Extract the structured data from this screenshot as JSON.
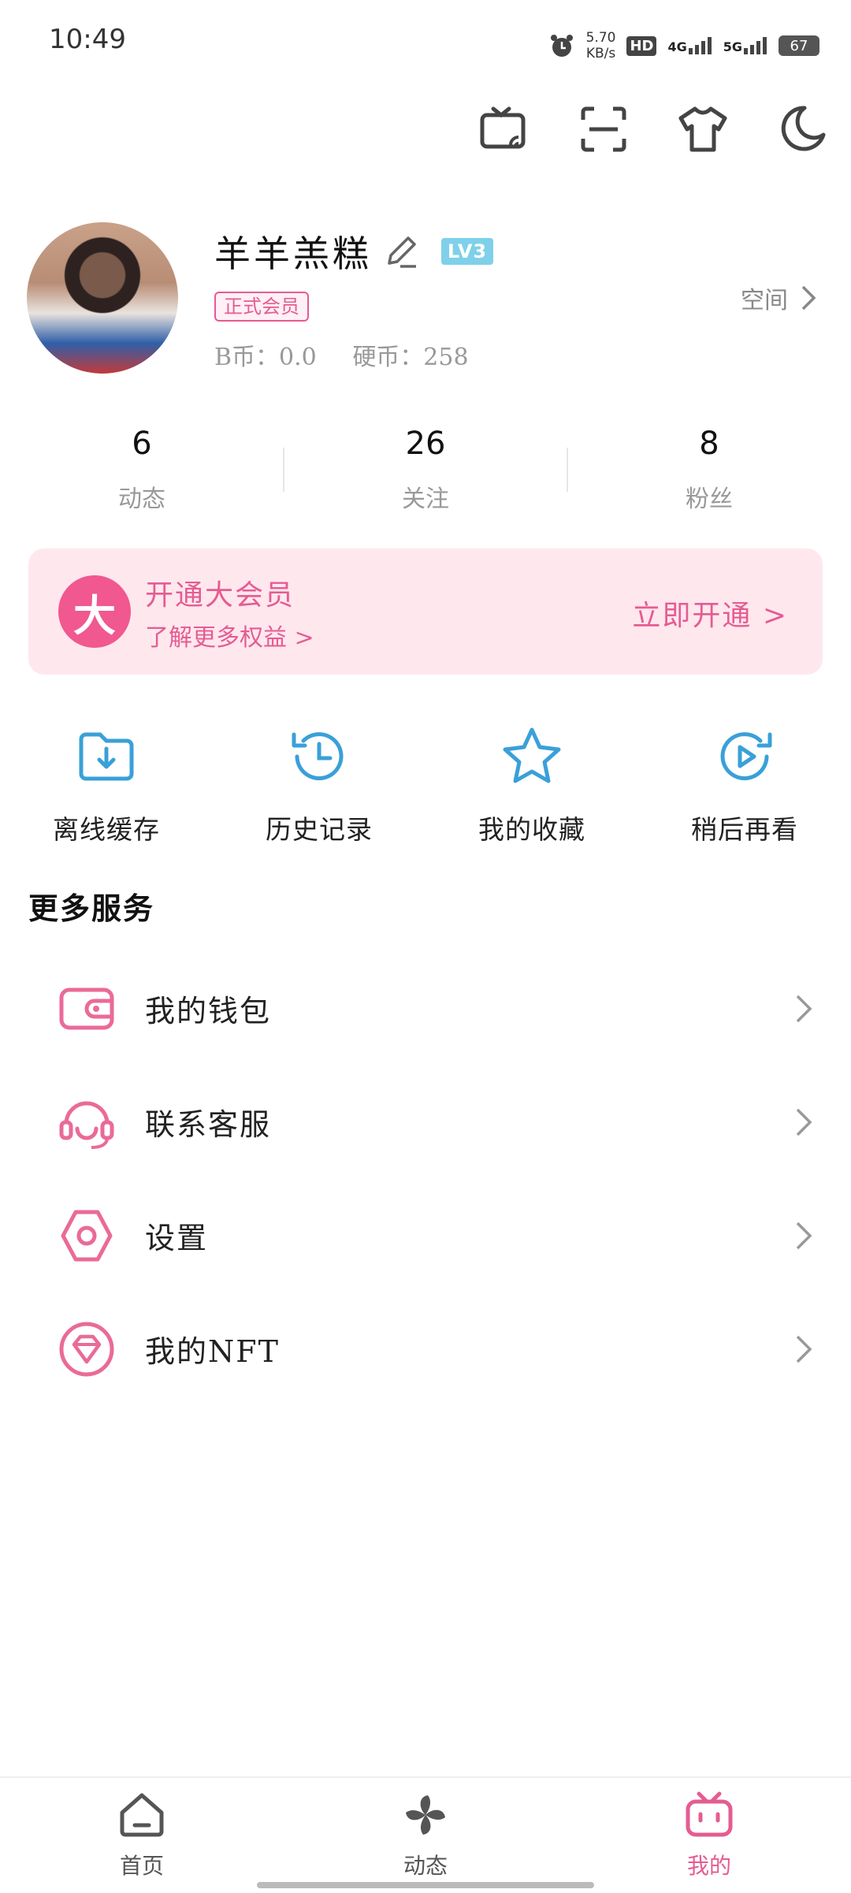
{
  "status_bar": {
    "time": "10:49",
    "speed_value": "5.70",
    "speed_unit": "KB/s",
    "hd": "HD",
    "net1": "4G",
    "net2": "5G",
    "battery": "67"
  },
  "top_actions": [
    "tv-cast-icon",
    "scan-icon",
    "tshirt-icon",
    "moon-icon"
  ],
  "profile": {
    "username": "羊羊羔糕",
    "level": "LV3",
    "vip_tag": "正式会员",
    "b_coin_label": "B币：0.0",
    "coin_label": "硬币：258",
    "space_link": "空间"
  },
  "stats": [
    {
      "value": "6",
      "label": "动态"
    },
    {
      "value": "26",
      "label": "关注"
    },
    {
      "value": "8",
      "label": "粉丝"
    }
  ],
  "vip_banner": {
    "badge": "大",
    "title": "开通大会员",
    "subtitle": "了解更多权益 >",
    "cta": "立即开通 >"
  },
  "quick_actions": [
    {
      "label": "离线缓存",
      "icon": "download-folder-icon"
    },
    {
      "label": "历史记录",
      "icon": "history-icon"
    },
    {
      "label": "我的收藏",
      "icon": "star-icon"
    },
    {
      "label": "稍后再看",
      "icon": "watch-later-icon"
    }
  ],
  "services": {
    "title": "更多服务",
    "items": [
      {
        "label": "我的钱包",
        "icon": "wallet-icon"
      },
      {
        "label": "联系客服",
        "icon": "headset-icon"
      },
      {
        "label": "设置",
        "icon": "settings-icon"
      },
      {
        "label": "我的NFT",
        "icon": "diamond-icon"
      }
    ]
  },
  "tabs": [
    {
      "label": "首页",
      "icon": "home-icon",
      "active": false
    },
    {
      "label": "动态",
      "icon": "pinwheel-icon",
      "active": false
    },
    {
      "label": "我的",
      "icon": "tv-mascot-icon",
      "active": true
    }
  ],
  "colors": {
    "accent": "#e55c92",
    "blue_icon": "#3aa0d8",
    "vip_bg": "#ffe7ee"
  }
}
